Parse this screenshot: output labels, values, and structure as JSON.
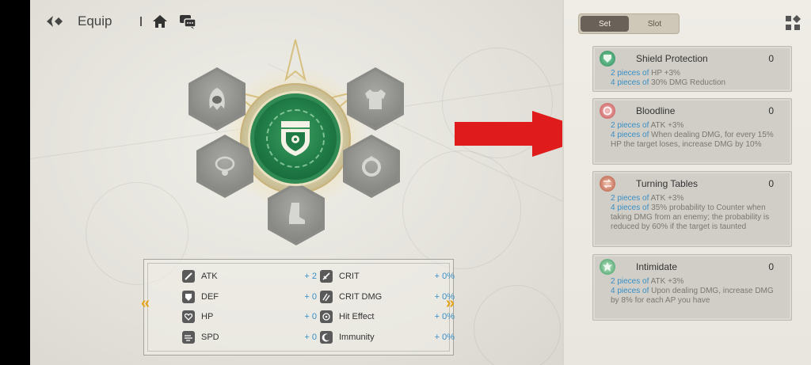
{
  "header": {
    "title": "Equip"
  },
  "icons": {
    "back": "back-sparkle-icon",
    "home": "home-icon",
    "chat": "chat-icon",
    "grid": "grid-icon",
    "set_emblem": "shield-emblem-icon"
  },
  "colors": {
    "accent_blue": "#3a8ec6",
    "nav_gold": "#e3a51c",
    "arrow_red": "#e01b1b",
    "core_green": "#1f7a45"
  },
  "equip_slots": [
    {
      "slot": "helmet",
      "icon": "hood-icon"
    },
    {
      "slot": "armor",
      "icon": "armor-icon"
    },
    {
      "slot": "necklace",
      "icon": "necklace-icon"
    },
    {
      "slot": "ring",
      "icon": "ring-icon"
    },
    {
      "slot": "boots",
      "icon": "boot-icon"
    }
  ],
  "stats": [
    {
      "label": "ATK",
      "value": "+ 2",
      "icon": "sword-icon"
    },
    {
      "label": "DEF",
      "value": "+ 0",
      "icon": "shield-icon"
    },
    {
      "label": "HP",
      "value": "+ 0",
      "icon": "heart-icon"
    },
    {
      "label": "SPD",
      "value": "+ 0",
      "icon": "wind-icon"
    },
    {
      "label": "CRIT",
      "value": "+ 0%",
      "icon": "blade-icon"
    },
    {
      "label": "CRIT DMG",
      "value": "+ 0%",
      "icon": "claw-icon"
    },
    {
      "label": "Hit Effect",
      "value": "+ 0%",
      "icon": "target-icon"
    },
    {
      "label": "Immunity",
      "value": "+ 0%",
      "icon": "moon-icon"
    }
  ],
  "nav": {
    "prev": "«",
    "next": "»"
  },
  "tabs": [
    {
      "label": "Set",
      "active": true
    },
    {
      "label": "Slot",
      "active": false
    }
  ],
  "sets": [
    {
      "name": "Shield Protection",
      "count": "0",
      "icon": "shield-set-icon",
      "lines": [
        {
          "pieces": "2 pieces of",
          "text": " HP +3%"
        },
        {
          "pieces": "4 pieces of",
          "text": " 30% DMG Reduction"
        }
      ]
    },
    {
      "name": "Bloodline",
      "count": "0",
      "icon": "bloodline-set-icon",
      "lines": [
        {
          "pieces": "2 pieces of",
          "text": " ATK +3%"
        },
        {
          "pieces": "4 pieces of",
          "text": " When dealing DMG, for every 15% HP the target loses, increase DMG by 10%"
        }
      ]
    },
    {
      "name": "Turning Tables",
      "count": "0",
      "icon": "turning-tables-set-icon",
      "lines": [
        {
          "pieces": "2 pieces of",
          "text": " ATK +3%"
        },
        {
          "pieces": "4 pieces of",
          "text": " 35% probability to Counter when taking DMG from an enemy; the probability is reduced by 60% if the target is taunted"
        }
      ]
    },
    {
      "name": "Intimidate",
      "count": "0",
      "icon": "intimidate-set-icon",
      "lines": [
        {
          "pieces": "2 pieces of",
          "text": " ATK +3%"
        },
        {
          "pieces": "4 pieces of",
          "text": " Upon dealing DMG, increase DMG by 8% for each AP you have"
        }
      ]
    }
  ]
}
